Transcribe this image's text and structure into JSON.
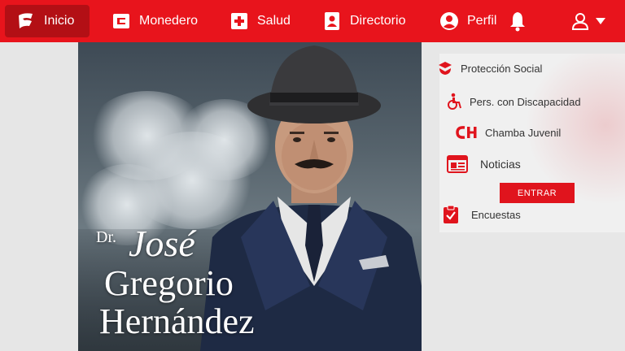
{
  "navbar": {
    "items": [
      {
        "label": "Inicio",
        "icon": "patria-logo-icon",
        "active": true
      },
      {
        "label": "Monedero",
        "icon": "wallet-icon"
      },
      {
        "label": "Salud",
        "icon": "health-cross-icon"
      },
      {
        "label": "Directorio",
        "icon": "contact-book-icon"
      },
      {
        "label": "Perfil",
        "icon": "profile-icon"
      }
    ],
    "notifications_icon": "bell-icon",
    "user_icon": "user-icon",
    "dropdown_icon": "caret-down-icon"
  },
  "poster": {
    "title_prefix": "Dr.",
    "name_line1": "José",
    "name_line2": "Gregorio",
    "name_line3": "Hernández"
  },
  "menu": {
    "items": [
      {
        "label": "Protección Social",
        "icon": "social-protection-icon"
      },
      {
        "label": "Pers. con Discapacidad",
        "icon": "wheelchair-icon"
      },
      {
        "label": "Chamba Juvenil",
        "icon": "ch-logo-icon"
      },
      {
        "label": "Noticias",
        "icon": "newspaper-icon"
      },
      {
        "label": "Encuestas",
        "icon": "clipboard-check-icon"
      }
    ],
    "enter_button": "ENTRAR"
  },
  "colors": {
    "brand_red": "#e8141c",
    "active_red": "#b30f15"
  }
}
